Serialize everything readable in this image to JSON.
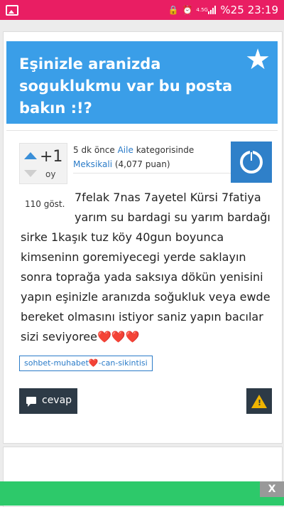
{
  "status_bar": {
    "battery_text": "%25",
    "time": "23:19",
    "network": "4.5G",
    "icons": [
      "gallery-icon",
      "lock-icon",
      "alarm-icon",
      "signal-icon"
    ]
  },
  "question": {
    "title": "Eşinizle aranizda soguklukmu var bu posta bakın :!?",
    "votes": "+1",
    "votes_label": "oy",
    "views": "110 göst.",
    "meta": {
      "time": "5 dk önce",
      "category": "Aile",
      "category_suffix": "kategorisinde",
      "author": "Meksikali",
      "points": "(4,077 puan)"
    },
    "content_line1": "7felak 7nas 7ayetel Kürsi 7fatiya",
    "content_line2": "yarım su bardagi su yarım bardağı",
    "content_rest": "sirke 1kaşık tuz köy 40gun boyunca kimseninn goremiyecegi yerde saklayın sonra toprağa yada saksıya dökün  yenisini yapın eşinizle aranızda soğukluk veya ewde bereket olmasını istiyor saniz yapın bacılar sizi seviyoree❤️❤️❤️",
    "tag": "sohbet-muhabet❤️-can-sikintisi",
    "answer_button": "cevap"
  },
  "ad": {
    "close_label": "X"
  },
  "colors": {
    "status_bar": "#e91e63",
    "title_box": "#3a9ee8",
    "link": "#2a7bc8",
    "button": "#2d3a46",
    "ad": "#2dc96a"
  }
}
